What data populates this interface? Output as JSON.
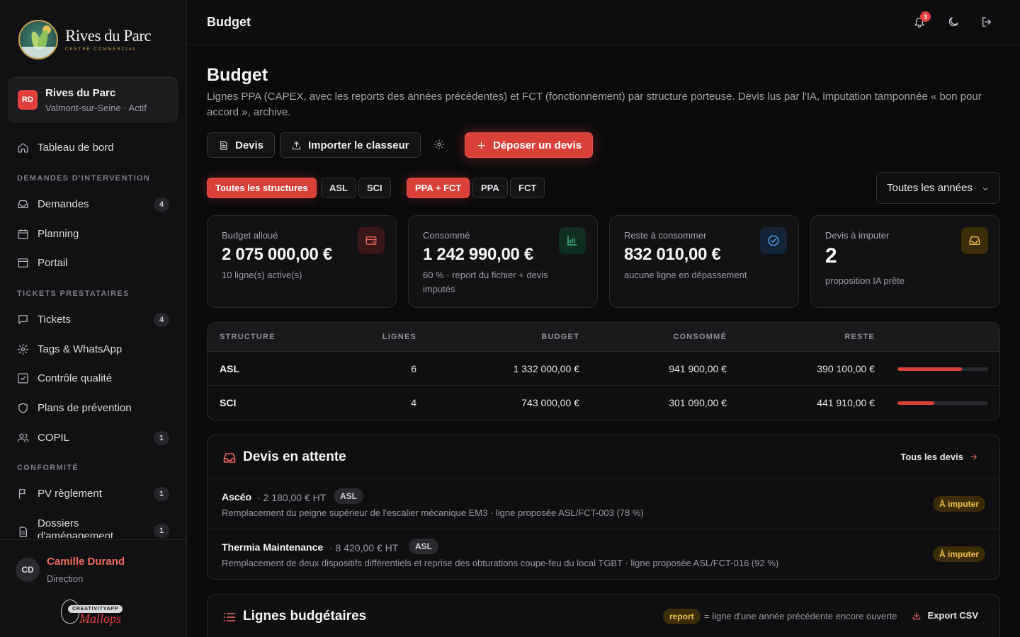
{
  "brand": {
    "name": "Rives du Parc",
    "tagline": "CENTRE COMMERCIAL"
  },
  "org": {
    "initials": "RD",
    "name": "Rives du Parc",
    "location": "Valmont-sur-Seine · Actif"
  },
  "sidebar": {
    "dashboard": "Tableau de bord",
    "sections": {
      "interventions": "DEMANDES D'INTERVENTION",
      "tickets": "TICKETS PRESTATAIRES",
      "conformite": "CONFORMITÉ"
    },
    "items": [
      {
        "label": "Demandes",
        "count": "4",
        "icon": "inbox-icon"
      },
      {
        "label": "Planning",
        "count": "",
        "icon": "calendar-icon"
      },
      {
        "label": "Portail",
        "count": "",
        "icon": "window-icon"
      },
      {
        "label": "Tickets",
        "count": "4",
        "icon": "message-icon"
      },
      {
        "label": "Tags & WhatsApp",
        "count": "",
        "icon": "gear-icon"
      },
      {
        "label": "Contrôle qualité",
        "count": "",
        "icon": "check-square-icon"
      },
      {
        "label": "Plans de prévention",
        "count": "",
        "icon": "shield-icon"
      },
      {
        "label": "COPIL",
        "count": "1",
        "icon": "users-icon"
      },
      {
        "label": "PV règlement",
        "count": "1",
        "icon": "flag-icon"
      },
      {
        "label": "Dossiers d'aménagement",
        "count": "1",
        "icon": "file-icon"
      }
    ]
  },
  "user": {
    "initials": "CD",
    "name": "Camille Durand",
    "role": "Direction"
  },
  "creator": {
    "badge": "CREATIVITYAPP",
    "script": "Mallops"
  },
  "topbar": {
    "title": "Budget",
    "notifications": "3"
  },
  "page": {
    "title": "Budget",
    "description": "Lignes PPA (CAPEX, avec les reports des années précédentes) et FCT (fonctionnement) par structure porteuse. Devis lus par l'IA, imputation tamponnée « bon pour accord », archive."
  },
  "actions": {
    "devis": "Devis",
    "import": "Importer le classeur",
    "deposit": "Déposer un devis"
  },
  "filters": {
    "structures": [
      "Toutes les structures",
      "ASL",
      "SCI"
    ],
    "types": [
      "PPA + FCT",
      "PPA",
      "FCT"
    ],
    "year": "Toutes les années"
  },
  "kpis": [
    {
      "label": "Budget alloué",
      "value": "2 075 000,00 €",
      "sub": "10 ligne(s) active(s)",
      "icon": "wallet-icon",
      "color": "#f06a5e"
    },
    {
      "label": "Consommé",
      "value": "1 242 990,00 €",
      "sub": "60 % · report du fichier + devis imputés",
      "icon": "bar-chart-icon",
      "color": "#4cc38a"
    },
    {
      "label": "Reste à consommer",
      "value": "832 010,00 €",
      "sub": "aucune ligne en dépassement",
      "icon": "check-circle-icon",
      "color": "#5aa7ff"
    },
    {
      "label": "Devis à imputer",
      "value": "2",
      "sub": "proposition IA prête",
      "icon": "inbox-icon",
      "color": "#f2c14a"
    }
  ],
  "structure_table": {
    "headers": [
      "STRUCTURE",
      "LIGNES",
      "BUDGET",
      "CONSOMMÉ",
      "RESTE"
    ],
    "rows": [
      {
        "structure": "ASL",
        "lignes": "6",
        "budget": "1 332 000,00 €",
        "consomme": "941 900,00 €",
        "reste": "390 100,00 €",
        "progress": 0.71
      },
      {
        "structure": "SCI",
        "lignes": "4",
        "budget": "743 000,00 €",
        "consomme": "301 090,00 €",
        "reste": "441 910,00 €",
        "progress": 0.41
      }
    ]
  },
  "pending": {
    "title": "Devis en attente",
    "link": "Tous les devis",
    "items": [
      {
        "vendor": "Ascéo",
        "amount": "· 2 180,00 € HT",
        "structure": "ASL",
        "description": "Remplacement du peigne supérieur de l'escalier mécanique EM3 · ligne proposée ASL/FCT-003 (78 %)",
        "status": "À imputer"
      },
      {
        "vendor": "Thermia Maintenance",
        "amount": "· 8 420,00 € HT",
        "structure": "ASL",
        "description": "Remplacement de deux dispositifs différentiels et reprise des obturations coupe-feu du local TGBT · ligne proposée ASL/FCT-016 (92 %)",
        "status": "À imputer"
      }
    ]
  },
  "lines": {
    "title": "Lignes budgétaires",
    "report_tag": "report",
    "report_desc": "= ligne d'une année précédente encore ouverte",
    "export": "Export CSV"
  },
  "colors": {
    "accent": "#d9403a",
    "amber": "#f2c14a",
    "background": "#0a0a0b"
  }
}
